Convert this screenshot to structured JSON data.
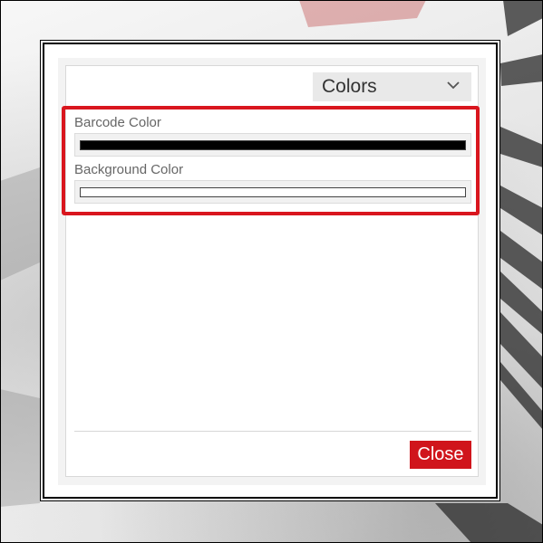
{
  "panel": {
    "selected_view": "Colors",
    "fields": [
      {
        "label": "Barcode Color",
        "color": "#000000"
      },
      {
        "label": "Background Color",
        "color": "#ffffff"
      }
    ]
  },
  "actions": {
    "close_label": "Close"
  },
  "colors": {
    "accent": "#d0151c",
    "highlight": "#d9161e"
  },
  "icons": {
    "dropdown": "chevron-down-icon"
  }
}
